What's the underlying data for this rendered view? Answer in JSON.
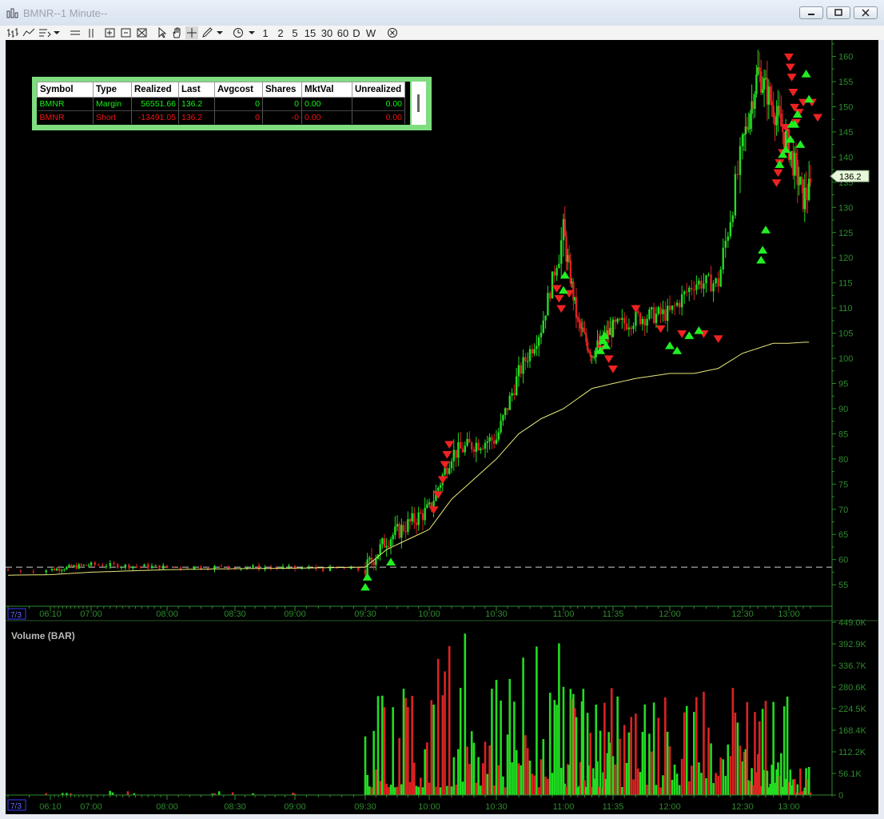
{
  "window": {
    "title": "BMNR--1 Minute--",
    "buttons": {
      "minimize": "minimize",
      "maximize": "maximize",
      "close": "close"
    }
  },
  "toolbar": {
    "icons": [
      "bar-chart-icon",
      "line-chart-icon",
      "chart-style-icon",
      "dropdown-icon",
      "horizontal-lines-icon",
      "vertical-lines-icon",
      "crosshair-zoom-icon",
      "expand-icon",
      "compress-icon",
      "cursor-icon",
      "hand-icon",
      "crosshair-icon",
      "pencil-icon",
      "dropdown-icon",
      "clock-icon",
      "dropdown-icon"
    ],
    "intervals": [
      "1",
      "2",
      "5",
      "15",
      "30",
      "60",
      "D",
      "W"
    ],
    "close_icon": "circle-x-icon"
  },
  "positions": {
    "headers": [
      "Symbol",
      "Type",
      "Realized",
      "Last",
      "Avgcost",
      "Shares",
      "MktVal",
      "Unrealized"
    ],
    "rows": [
      [
        "BMNR",
        "Margin",
        "56551.66",
        "136.2",
        "0",
        "0",
        "0.00",
        "0.00"
      ],
      [
        "BMNR",
        "Short",
        "-13491.05",
        "136.2",
        "0",
        "-0",
        "0.00",
        "0.00"
      ]
    ]
  },
  "price_panel": {
    "last_price_label": "136.2",
    "y_ticks": [
      "160",
      "155",
      "150",
      "145",
      "140",
      "135",
      "130",
      "125",
      "120",
      "115",
      "110",
      "105",
      "100",
      "95",
      "90",
      "85",
      "80",
      "75",
      "70",
      "65",
      "60",
      "55"
    ],
    "date_label": "7/3",
    "x_ticks": [
      "06:10",
      "07:00",
      "08:00",
      "08:30",
      "09:00",
      "09:30",
      "10:00",
      "10:30",
      "11:00",
      "11:35",
      "12:00",
      "12:30",
      "13:00"
    ]
  },
  "volume_panel": {
    "title": "Volume (BAR)",
    "y_ticks": [
      "449.0K",
      "392.9K",
      "336.7K",
      "280.6K",
      "224.5K",
      "168.4K",
      "112.2K",
      "56.1K",
      "0"
    ],
    "date_label": "7/3",
    "x_ticks": [
      "06:10",
      "07:00",
      "08:00",
      "08:30",
      "09:00",
      "09:30",
      "10:00",
      "10:30",
      "11:00",
      "11:35",
      "12:00",
      "12:30",
      "13:00"
    ]
  },
  "colors": {
    "background": "#000000",
    "up": "#22dd22",
    "down": "#dd2222",
    "axis": "#2f8a2f",
    "ma_line": "#e8e87a",
    "buy_marker": "#22ee22",
    "sell_marker": "#ee2222"
  },
  "chart_data": {
    "type": "line",
    "title": "BMNR--1 Minute--",
    "xlabel": "",
    "ylabel": "",
    "ylim": [
      52,
      162
    ],
    "x": [
      "06:10",
      "07:00",
      "08:00",
      "08:30",
      "09:00",
      "09:30",
      "09:40",
      "10:00",
      "10:10",
      "10:20",
      "10:30",
      "10:40",
      "10:50",
      "11:00",
      "11:10",
      "11:20",
      "11:35",
      "11:45",
      "12:00",
      "12:10",
      "12:20",
      "12:30",
      "12:40",
      "12:50",
      "13:00",
      "13:10",
      "13:20"
    ],
    "series": [
      {
        "values": [
          58,
          59,
          58.5,
          58.5,
          58.3,
          58,
          64,
          70,
          81,
          83,
          84,
          97,
          106,
          125,
          107,
          101,
          106,
          108,
          109,
          115,
          115,
          142,
          157,
          150,
          142,
          132,
          135
        ]
      },
      {
        "values": [
          57,
          57.5,
          58,
          58.2,
          58.3,
          58.5,
          62,
          66,
          72,
          76,
          80,
          85,
          88,
          90,
          92,
          94,
          95,
          96,
          97,
          97,
          98,
          101,
          102,
          103,
          103,
          103.2,
          103.2
        ]
      }
    ],
    "reference_line": 58.5
  }
}
